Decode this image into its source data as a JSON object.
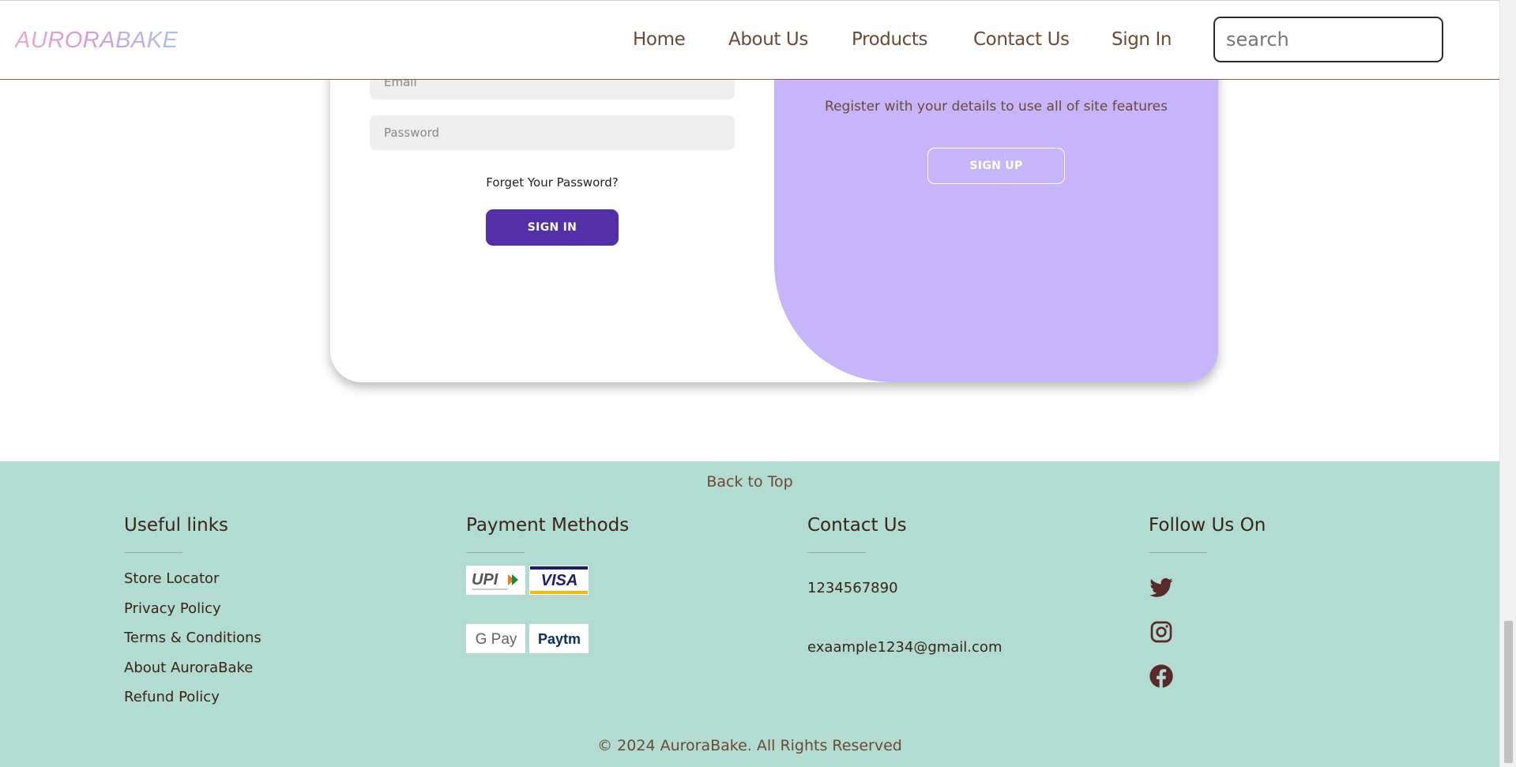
{
  "header": {
    "logo": "AURORABAKE",
    "nav": [
      "Home",
      "About Us",
      "Products",
      "Contact Us",
      "Sign In"
    ],
    "search_placeholder": "search"
  },
  "auth": {
    "email_placeholder": "Email",
    "password_placeholder": "Password",
    "forgot": "Forget Your Password?",
    "signin_button": "SIGN IN",
    "register_text": "Register with your details to use all of site features",
    "signup_button": "SIGN UP"
  },
  "footer": {
    "back_to_top": "Back to Top",
    "useful_links": {
      "heading": "Useful links",
      "items": [
        "Store Locator",
        "Privacy Policy",
        "Terms & Conditions",
        "About AuroraBake",
        "Refund Policy"
      ]
    },
    "payment_methods": {
      "heading": "Payment Methods",
      "logos": [
        "UPI",
        "VISA",
        "G Pay",
        "Paytm"
      ]
    },
    "contact": {
      "heading": "Contact Us",
      "phone": "1234567890",
      "email": "exaample1234@gmail.com"
    },
    "follow": {
      "heading": "Follow Us On",
      "icons": [
        "twitter-icon",
        "instagram-icon",
        "facebook-icon"
      ]
    },
    "copyright": "© 2024 AuroraBake. All Rights Reserved"
  },
  "colors": {
    "primary_button": "#5430a8",
    "panel": "#c6b5fb",
    "footer_bg": "#b2dbd2",
    "nav_text": "#6b4a34",
    "social_icon": "#5a2a2a"
  }
}
